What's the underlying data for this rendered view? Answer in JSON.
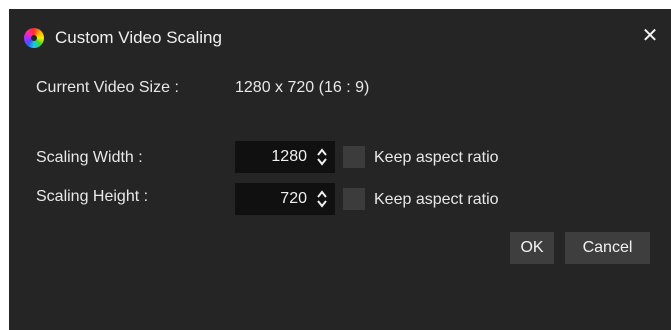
{
  "window": {
    "title": "Custom Video Scaling",
    "app_icon": "color-wheel-icon",
    "close_glyph": "✕"
  },
  "current_size": {
    "label": "Current Video Size :",
    "value": "1280 x 720 (16 : 9)"
  },
  "width": {
    "label": "Scaling Width :",
    "value": "1280",
    "keep_aspect_label": "Keep aspect ratio",
    "keep_aspect_checked": false
  },
  "height": {
    "label": "Scaling Height :",
    "value": "720",
    "keep_aspect_label": "Keep aspect ratio",
    "keep_aspect_checked": false
  },
  "buttons": {
    "ok": "OK",
    "cancel": "Cancel"
  },
  "colors": {
    "background": "#252525",
    "field": "#101010",
    "button": "#3e3e3e"
  }
}
